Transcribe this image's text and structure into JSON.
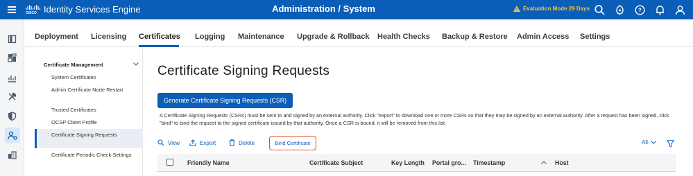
{
  "header": {
    "app_name": "Identity Services Engine",
    "title": "Administration / System",
    "eval_text": "Evaluation Mode 29 Days",
    "colors": {
      "brand": "#0b5eb8",
      "warning": "#f5c242"
    }
  },
  "tabs": [
    {
      "label": "Deployment"
    },
    {
      "label": "Licensing"
    },
    {
      "label": "Certificates",
      "active": true
    },
    {
      "label": "Logging"
    },
    {
      "label": "Maintenance"
    },
    {
      "label": "Upgrade & Rollback"
    },
    {
      "label": "Health Checks"
    },
    {
      "label": "Backup & Restore"
    },
    {
      "label": "Admin Access"
    },
    {
      "label": "Settings"
    }
  ],
  "rail_icons": [
    "bookmark-icon",
    "dashboard-icon",
    "context-visibility-icon",
    "operations-icon",
    "policy-icon",
    "administration-icon",
    "work-centers-icon"
  ],
  "sidebar": {
    "heading": "Certificate Management",
    "items": [
      {
        "label": "System Certificates"
      },
      {
        "label": "Admin Certificate Node Restart"
      },
      {
        "label": "Trusted Certificates"
      },
      {
        "label": "OCSP Client Profile"
      },
      {
        "label": "Certificate Signing Requests",
        "active": true
      },
      {
        "label": "Certificate Periodic Check Settings"
      }
    ]
  },
  "main": {
    "title": "Certificate Signing Requests",
    "generate_button": "Generate Certificate Signing Requests (CSR)",
    "description": "A Certificate Signing Requests (CSRs) must be sent to and signed by an external authority. Click \"export\" to download one or more CSRs so that they may be signed by an external authority. After a request has been signed, click \"bind\" to bind the request to the signed certificate issued by that authority. Once a CSR is bound, it will be removed from this list.",
    "actions": {
      "view": "View",
      "export": "Export",
      "delete": "Delete",
      "bind": "Bind Certificate"
    },
    "filter_label": "All",
    "columns": [
      "Friendly Name",
      "Certificate Subject",
      "Key Length",
      "Portal gro...",
      "Timestamp",
      "Host"
    ]
  }
}
